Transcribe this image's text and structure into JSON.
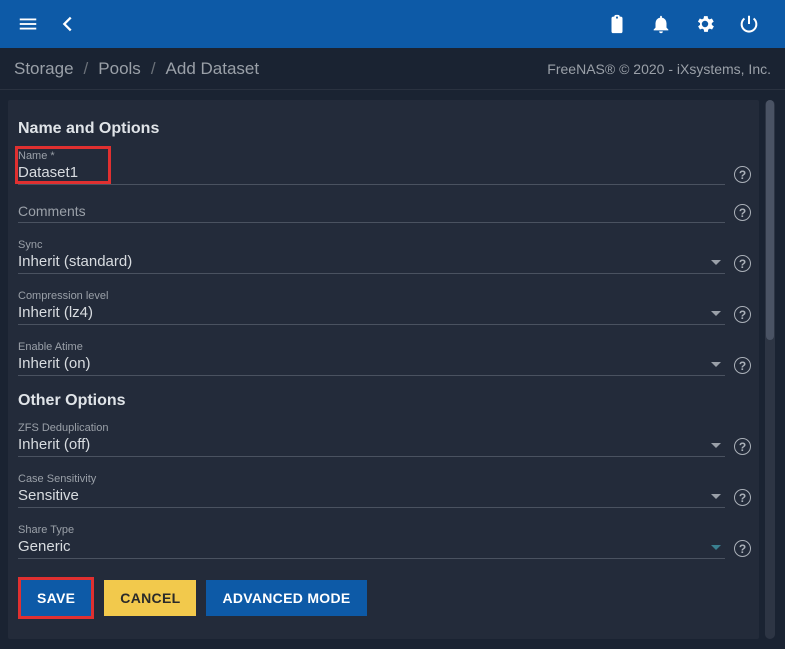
{
  "topbar": {
    "menu_icon": "menu",
    "back_icon": "back"
  },
  "breadcrumbs": {
    "item0": "Storage",
    "item1": "Pools",
    "item2": "Add Dataset"
  },
  "copyright": "FreeNAS® © 2020 - iXsystems, Inc.",
  "section1_title": "Name and Options",
  "section2_title": "Other Options",
  "fields": {
    "name": {
      "label": "Name *",
      "value": "Dataset1"
    },
    "comments": {
      "label": "Comments",
      "value": ""
    },
    "sync": {
      "label": "Sync",
      "value": "Inherit (standard)"
    },
    "compression": {
      "label": "Compression level",
      "value": "Inherit (lz4)"
    },
    "atime": {
      "label": "Enable Atime",
      "value": "Inherit (on)"
    },
    "dedup": {
      "label": "ZFS Deduplication",
      "value": "Inherit (off)"
    },
    "casesens": {
      "label": "Case Sensitivity",
      "value": "Sensitive"
    },
    "sharetype": {
      "label": "Share Type",
      "value": "Generic"
    }
  },
  "buttons": {
    "save": "SAVE",
    "cancel": "CANCEL",
    "advanced": "ADVANCED MODE"
  }
}
